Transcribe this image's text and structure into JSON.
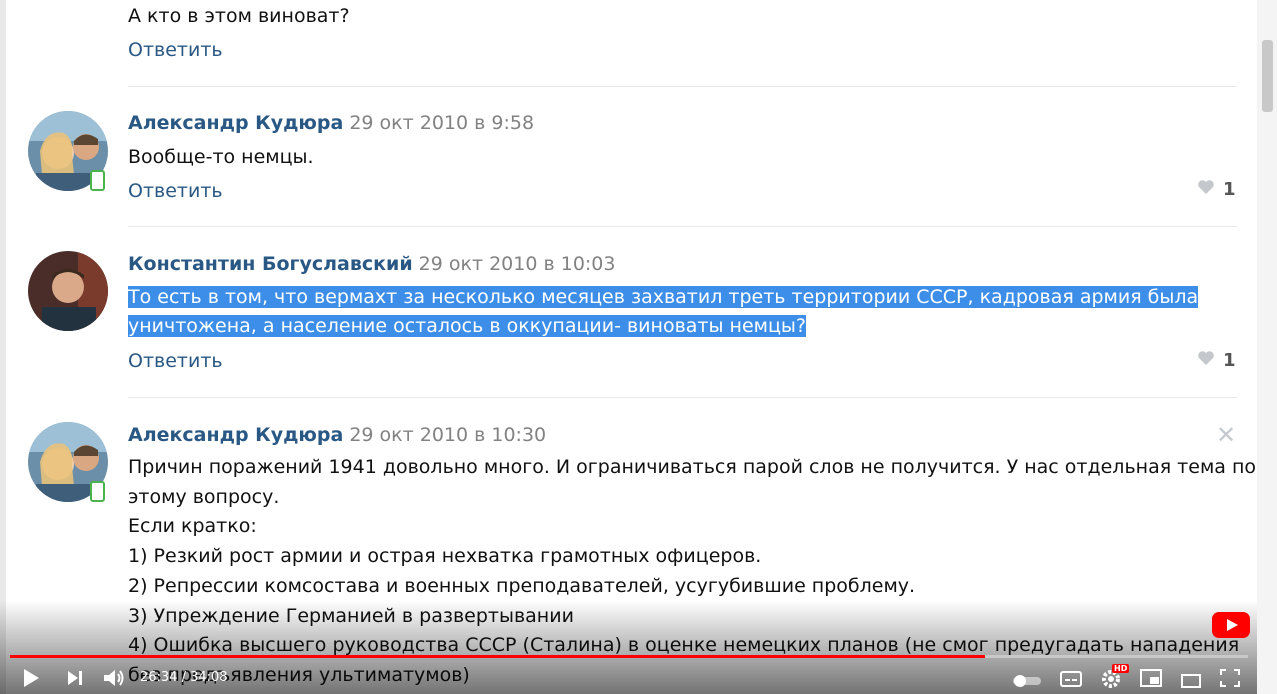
{
  "comments": [
    {
      "text": "А кто в этом виноват?",
      "reply_label": "Ответить"
    },
    {
      "author": "Александр Кудюра",
      "date": "29 окт 2010 в 9:58",
      "lines": [
        "Вообще-то немцы."
      ],
      "reply_label": "Ответить",
      "likes": "1"
    },
    {
      "author": "Константин Богуславский",
      "date": "29 окт 2010 в 10:03",
      "lines": [
        "То есть в том, что вермахт за несколько месяцев захватил треть территории СССР, кадровая армия была",
        "уничтожена, а население осталось в оккупации- виноваты немцы?"
      ],
      "reply_label": "Ответить",
      "likes": "1"
    },
    {
      "author": "Александр Кудюра",
      "date": "29 окт 2010 в 10:30",
      "lines": [
        "Причин поражений 1941 довольно много. И ограничиваться парой слов не получится. У нас отдельная тема по",
        "этому вопросу.",
        "Если кратко:",
        "1) Резкий рост армии и острая нехватка грамотных офицеров.",
        "2) Репрессии комсостава и военных преподавателей, усугубившие проблему.",
        "3) Упреждение Германией в развертывании",
        "4) Ошибка высшего руководства СССР (Сталина) в оценке немецких планов (не смог предугадать нападения",
        "без предъявления ультиматумов)"
      ],
      "close_icon": "close-icon"
    }
  ],
  "player": {
    "time": "26:34 / 34:08",
    "progress": 0.7875,
    "hd_badge": "HD",
    "colors": {
      "progress": "#ff0000",
      "logo": "#ff0000"
    }
  },
  "colors": {
    "link": "#2a5885",
    "date": "#828282",
    "highlight": "#3d8ee9",
    "online": "#4bb34b"
  }
}
